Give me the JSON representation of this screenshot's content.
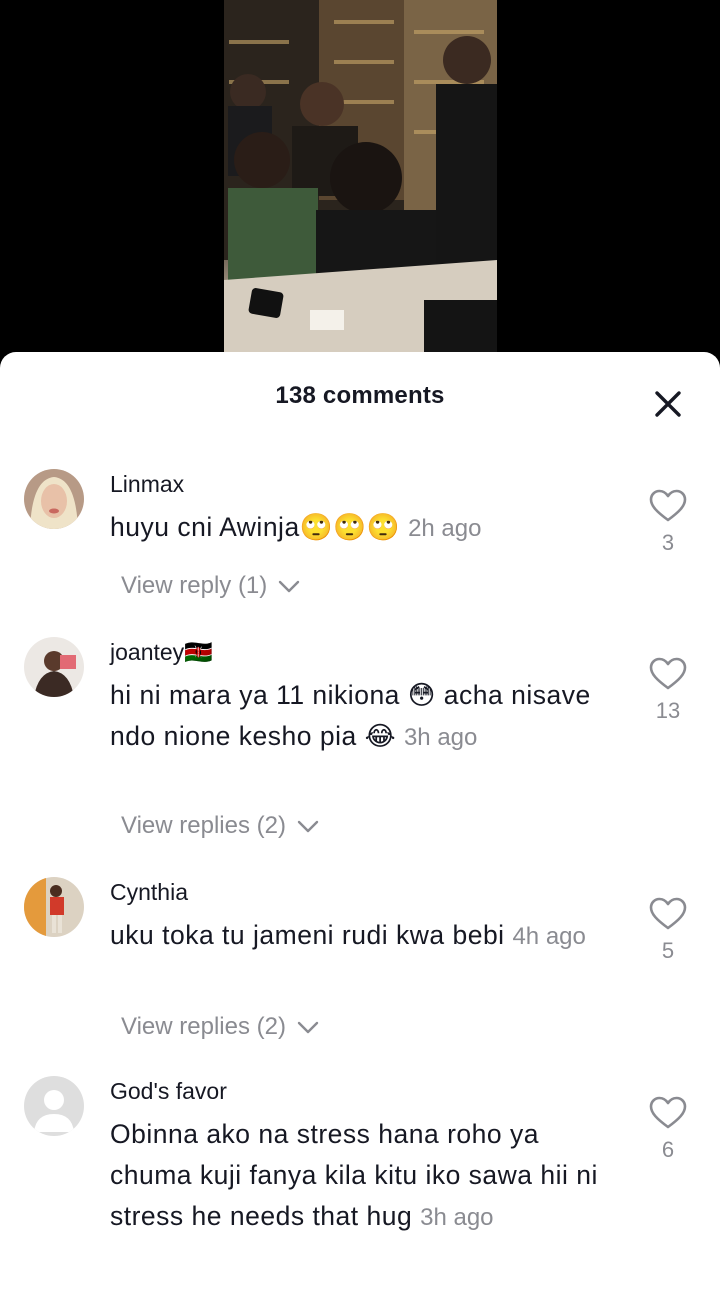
{
  "header": {
    "comments_title": "138 comments"
  },
  "icons": {
    "close": "close-icon",
    "like": "heart-outline-icon",
    "replies_chevron": "chevron-down-icon"
  },
  "colors": {
    "text_primary": "#161823",
    "text_secondary": "#8a8b91",
    "sheet_bg": "#ffffff",
    "backdrop": "#000000"
  },
  "comments": [
    {
      "username": "Linmax",
      "text": "huyu cni Awinja",
      "emoji": "🙄🙄🙄",
      "time": "2h ago",
      "likes": "3",
      "replies": "View reply (1)"
    },
    {
      "username": "joantey",
      "flag": "🇰🇪",
      "text1": "hi ni mara ya 11 nikiona",
      "emoji1": "😳",
      "text2": " acha nisave ndo nione kesho pia",
      "emoji2": "😂",
      "time": "3h ago",
      "likes": "13",
      "replies": "View replies (2)"
    },
    {
      "username": "Cynthia",
      "text": "uku toka tu jameni rudi kwa bebi",
      "time": "4h ago",
      "likes": "5",
      "replies": "View replies (2)"
    },
    {
      "username": "God's favor",
      "text": "Obinna ako na stress hana roho ya chuma kuji fanya kila kitu iko sawa hii ni stress he needs that hug",
      "time": "3h ago",
      "likes": "6"
    }
  ]
}
